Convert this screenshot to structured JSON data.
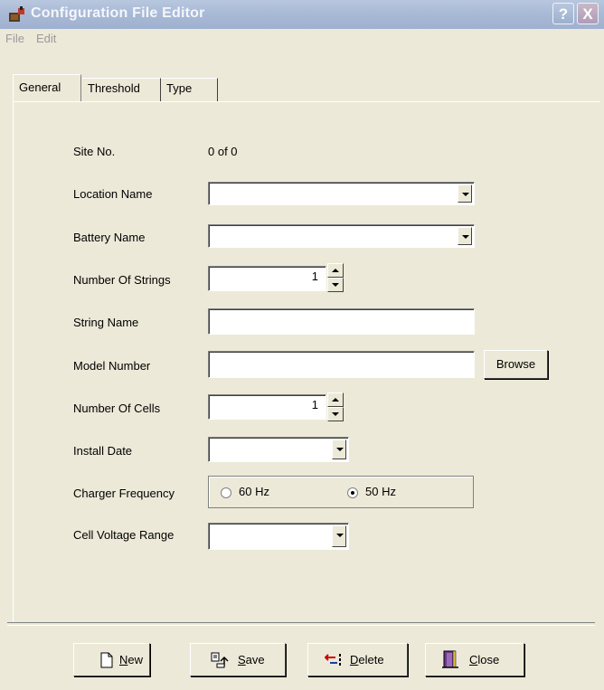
{
  "window": {
    "title": "Configuration File Editor"
  },
  "titlebar_buttons": {
    "help": "?",
    "close": "X"
  },
  "menu": [
    {
      "label": "File"
    },
    {
      "label": "Edit"
    }
  ],
  "tabs": [
    {
      "label": "General",
      "active": true
    },
    {
      "label": "Threshold",
      "active": false
    },
    {
      "label": "Type",
      "active": false
    }
  ],
  "form": {
    "site_no_label": "Site No.",
    "site_no_value": "0 of 0",
    "location_name_label": "Location Name",
    "location_name_value": "",
    "battery_name_label": "Battery Name",
    "battery_name_value": "",
    "number_of_strings_label": "Number Of Strings",
    "number_of_strings_value": "1",
    "string_name_label": "String Name",
    "string_name_value": "",
    "model_number_label": "Model Number",
    "model_number_value": "",
    "browse_label": "Browse",
    "number_of_cells_label": "Number Of Cells",
    "number_of_cells_value": "1",
    "install_date_label": "Install Date",
    "install_date_value": "",
    "charger_frequency_label": "Charger Frequency",
    "freq_60_label": "60 Hz",
    "freq_50_label": "50 Hz",
    "freq_selected": "50 Hz",
    "cell_voltage_range_label": "Cell Voltage Range",
    "cell_voltage_range_value": ""
  },
  "footer_buttons": {
    "new_u": "N",
    "new_rest": "ew",
    "save_u": "S",
    "save_rest": "ave",
    "delete_u": "D",
    "delete_rest": "elete",
    "close_u": "C",
    "close_rest": "lose"
  },
  "icons": [
    "app-icon",
    "new-document-icon",
    "save-icon",
    "delete-icon",
    "close-door-icon"
  ]
}
